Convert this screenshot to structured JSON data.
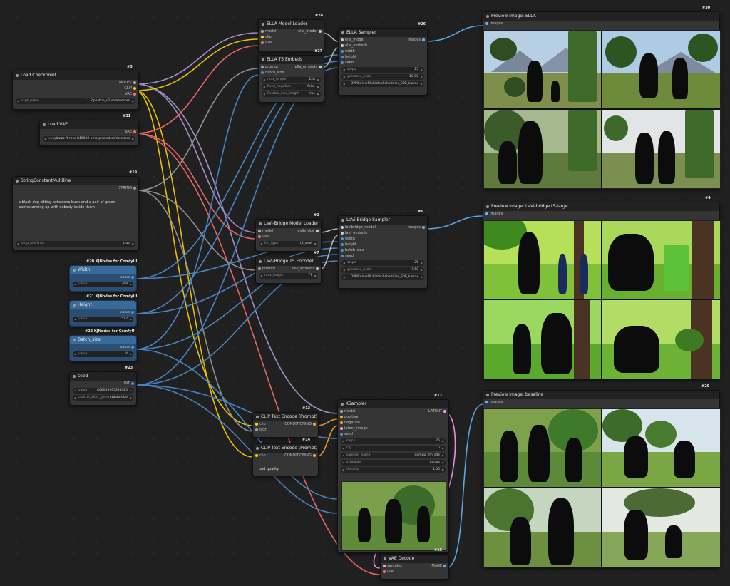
{
  "nodes": {
    "load_checkpoint": {
      "id": "#3",
      "title": "Load Checkpoint",
      "outputs": [
        "MODEL",
        "CLIP",
        "VAE"
      ],
      "widget_label": "ckpt_name",
      "widget_value": "1.5\\photon_v1.safetensors"
    },
    "load_vae": {
      "id": "#31",
      "title": "Load VAE",
      "outputs": [
        "VAE"
      ],
      "widget_label": "vae_name",
      "widget_value": "sd-vae-ft-mse-840000-ema-pruned.safetensors"
    },
    "string_constant": {
      "id": "#19",
      "title": "StringConstantMultiline",
      "output": "STRING",
      "text": "a black dog sitting betweena bush and a pair of green pantsstanding up with nobody inside them",
      "widget_label": "strip_newlines",
      "widget_value": "true"
    },
    "width": {
      "id": "#20 KJNodes for ComfyUI",
      "title": "Width",
      "output": "value",
      "widget_label": "value",
      "widget_value": "768"
    },
    "height": {
      "id": "#21 KJNodes for ComfyUI",
      "title": "Height",
      "output": "value",
      "widget_label": "value",
      "widget_value": "512"
    },
    "batch": {
      "id": "#22 KJNodes for ComfyUI",
      "title": "Batch_size",
      "output": "value",
      "widget_label": "value",
      "widget_value": "4"
    },
    "seed": {
      "id": "#23",
      "title": "seed",
      "output": "INT",
      "widgets": [
        {
          "label": "value",
          "value": "806083995338085"
        },
        {
          "label": "control_after_generate",
          "value": "randomize"
        }
      ]
    },
    "ella_loader": {
      "id": "#24",
      "title": "ELLA Model Loader",
      "inputs": [
        "model",
        "clip",
        "vae"
      ],
      "output": "ella_model"
    },
    "ella_t5": {
      "id": "#27",
      "title": "ELLA T5 Embeds",
      "inputs": [
        "prompt",
        "batch_size"
      ],
      "output": "ella_embeds",
      "widgets": [
        {
          "label": "max_length",
          "value": "128"
        },
        {
          "label": "fixed_negative",
          "value": "false"
        },
        {
          "label": "flexible_max_length",
          "value": "true"
        }
      ]
    },
    "ella_sampler": {
      "id": "#26",
      "title": "ELLA Sampler",
      "inputs": [
        "ella_model",
        "ella_embeds",
        "width",
        "height",
        "seed"
      ],
      "output": "images",
      "widgets": [
        {
          "label": "steps",
          "value": "25"
        },
        {
          "label": "guidance_scale",
          "value": "10.00"
        },
        {
          "label": "scheduler",
          "value": "DPMSolverMultistepScheduler_SDE_karras"
        }
      ]
    },
    "lavi_loader": {
      "id": "#2",
      "title": "LaVi-Bridge Model Loader",
      "inputs": [
        "model",
        "vae"
      ],
      "output": "lavibridge",
      "widget_label": "llm_type",
      "widget_value": "t5_unet"
    },
    "lavi_t5": {
      "id": "#7",
      "title": "LaVi-Bridge T5 Encoder",
      "inputs": [
        "prompt"
      ],
      "output": "lavi_embeds",
      "widget_label": "max_length",
      "widget_value": "77"
    },
    "lavi_sampler": {
      "id": "#6",
      "title": "LaVi-Bridge Sampler",
      "inputs": [
        "lavibridge_model",
        "lavi_embeds",
        "width",
        "height",
        "batch_size",
        "seed"
      ],
      "output": "images",
      "widgets": [
        {
          "label": "steps",
          "value": "25"
        },
        {
          "label": "guidance_scale",
          "value": "7.50"
        },
        {
          "label": "scheduler",
          "value": "DPMSolverMultistepScheduler_SDE_karras"
        }
      ]
    },
    "clip_pos": {
      "id": "#13",
      "title": "CLIP Text Encode (Prompt)",
      "inputs": [
        "clip",
        "text"
      ],
      "output": "CONDITIONING"
    },
    "clip_neg": {
      "id": "#14",
      "title": "CLIP Text Encode (Prompt)",
      "inputs": [
        "clip"
      ],
      "output": "CONDITIONING",
      "text": "bad quality"
    },
    "ksampler": {
      "id": "#12",
      "title": "KSampler",
      "inputs": [
        "model",
        "positive",
        "negative",
        "latent_image",
        "seed"
      ],
      "output": "LATENT",
      "widgets": [
        {
          "label": "steps",
          "value": "25"
        },
        {
          "label": "cfg",
          "value": "7.5"
        },
        {
          "label": "sampler_name",
          "value": "dpmpp_2m_sde"
        },
        {
          "label": "scheduler",
          "value": "karras"
        },
        {
          "label": "denoise",
          "value": "1.00"
        }
      ]
    },
    "vae_decode": {
      "id": "#15",
      "title": "VAE Decode",
      "inputs": [
        "samples",
        "vae"
      ],
      "output": "IMAGE"
    },
    "preview_ella": {
      "id": "#30",
      "title": "Preview Image: ELLA",
      "input": "images"
    },
    "preview_lavi": {
      "id": "#4",
      "title": "Preview Image: LaVi-bridge t5-large",
      "input": "images"
    },
    "preview_base": {
      "id": "#29",
      "title": "Preview Image: baseline",
      "input": "images"
    }
  },
  "colors": {
    "model": "#b39ddb",
    "clip": "#ffd500",
    "vae": "#ff6e6e",
    "conditioning": "#ffa931",
    "latent": "#ff9cf9",
    "image": "#64b5f6",
    "string": "#9e9e9e",
    "int": "#5c9ee8",
    "custom": "#cccccc"
  },
  "icons": [
    "menu-icon",
    "plugin-badge-icon"
  ]
}
